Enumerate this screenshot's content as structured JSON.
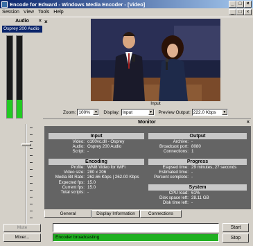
{
  "window": {
    "title": "Encode for Edward - Windows Media Encoder - [Video]",
    "min": "_",
    "max": "□",
    "close": "×"
  },
  "menu": [
    "Session",
    "View",
    "Tools",
    "Help"
  ],
  "mdi_controls": [
    "_",
    "□",
    "×"
  ],
  "audio": {
    "title": "Audio",
    "close": "×",
    "source": "Osprey 200 Audio",
    "levels": [
      0.22,
      0.22
    ],
    "volume": 0.82,
    "mute_label": "Mute",
    "mixer_label": "Mixer..."
  },
  "video": {
    "close": "×",
    "caption": "Input"
  },
  "controls": {
    "zoom_label": "Zoom:",
    "zoom_value": "100%",
    "display_label": "Display:",
    "display_value": "Input",
    "preview_label": "Preview Output:",
    "preview_value": "222.0 Kbps"
  },
  "monitor": {
    "title": "Monitor",
    "close": "×",
    "input": {
      "title": "Input",
      "rows": [
        {
          "k": "Video:",
          "v": "o100vc.dll - Osprey"
        },
        {
          "k": "Audio:",
          "v": "Osprey 200 Audio"
        },
        {
          "k": "Script:",
          "v": "-"
        }
      ]
    },
    "output": {
      "title": "Output",
      "rows": [
        {
          "k": "Archive:",
          "v": "-"
        },
        {
          "k": "Broadcast port:",
          "v": "8080"
        },
        {
          "k": "Connections:",
          "v": "1"
        }
      ]
    },
    "encoding": {
      "title": "Encoding",
      "rows": [
        {
          "k": "Profile:",
          "v": "WM8 Video for WiFi"
        },
        {
          "k": "Video size:",
          "v": "280 x 206"
        },
        {
          "k": "Media Bit Rate:",
          "v": "262.66 Kbps | 262.00 Kbps"
        },
        {
          "k": "Expected fps:",
          "v": "15.0"
        },
        {
          "k": "Current fps:",
          "v": "15.0"
        },
        {
          "k": "Total scripts:",
          "v": "-"
        }
      ]
    },
    "progress": {
      "title": "Progress",
      "rows": [
        {
          "k": "Elapsed time:",
          "v": "29 minutes, 27 seconds"
        },
        {
          "k": "Estimated time:",
          "v": "-"
        },
        {
          "k": "Percent complete:",
          "v": "-"
        }
      ]
    },
    "system": {
      "title": "System",
      "rows": [
        {
          "k": "CPU load:",
          "v": "61%"
        },
        {
          "k": "Disk space left:",
          "v": "28.11 GB"
        },
        {
          "k": "Disk time left:",
          "v": "-"
        }
      ]
    }
  },
  "tabs": [
    "General",
    "Display Information",
    "Connections"
  ],
  "status": {
    "message": "",
    "progress_text": "Encoder broadcasting"
  },
  "buttons": {
    "start": "Start",
    "stop": "Stop"
  }
}
